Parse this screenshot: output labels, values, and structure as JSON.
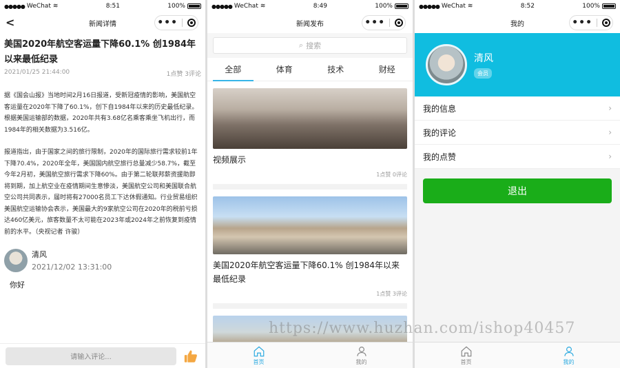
{
  "status": {
    "screen1": {
      "carrier": "WeChat",
      "time": "8:51",
      "battery": "100%"
    },
    "screen2": {
      "carrier": "WeChat",
      "time": "8:49",
      "battery": "100%"
    },
    "screen3": {
      "carrier": "WeChat",
      "time": "8:52",
      "battery": "100%"
    }
  },
  "detail": {
    "nav_title": "新闻详情",
    "title": "美国2020年航空客运量下降60.1% 创1984年以来最低纪录",
    "date": "2021/01/25 21:44:00",
    "stats": "1点赞 3评论",
    "para1": "据《国会山报》当地时间2月16日报道，受新冠疫情的影响，美国航空客运量在2020年下降了60.1%，创下自1984年以来的历史最低纪录。根据美国运输部的数据，2020年共有3.68亿名乘客乘坐飞机出行，而1984年的相关数据为3.516亿。",
    "para2": "报道指出，由于国家之间的旅行限制，2020年的国际旅行需求较前1年下降70.4%，2020年全年，美国国内航空旅行总量减少58.7%，截至今年2月初，美国航空旅行需求下降60%。由于第二轮联邦薪资援助即将到期，加上航空业在疫情期间生意惨淡，美国航空公司和美国联合航空公司共同表示，届时将有27000名员工下达休假通知。行业贸易组织美国航空运输协会表示，美国最大的9家航空公司在2020年的税前亏损达460亿美元，旅客数量不太可能在2023年或2024年之前恢复到疫情前的水平。（央视记者 许骏）",
    "comment": {
      "user": "清风",
      "time": "2021/12/02 13:31:00",
      "text": "你好"
    },
    "comment_placeholder": "请输入评论..."
  },
  "news": {
    "nav_title": "新闻发布",
    "search_placeholder": "搜索",
    "tabs": [
      "全部",
      "体育",
      "技术",
      "财经"
    ],
    "items": [
      {
        "title": "视频展示",
        "meta": "1点赞 0评论"
      },
      {
        "title": "美国2020年航空客运量下降60.1% 创1984年以来最低纪录",
        "meta": "1点赞 3评论"
      }
    ],
    "tabbar": {
      "home": "首页",
      "mine": "我的"
    }
  },
  "mine": {
    "nav_title": "我的",
    "name": "清风",
    "badge": "会员",
    "menu": [
      "我的信息",
      "我的评论",
      "我的点赞"
    ],
    "logout": "退出",
    "tabbar": {
      "home": "首页",
      "mine": "我的"
    }
  },
  "watermark": "https://www.huzhan.com/ishop40457",
  "colors": {
    "accent": "#10bde0",
    "logout": "#1aad19",
    "active_tab": "#36b5e8"
  }
}
